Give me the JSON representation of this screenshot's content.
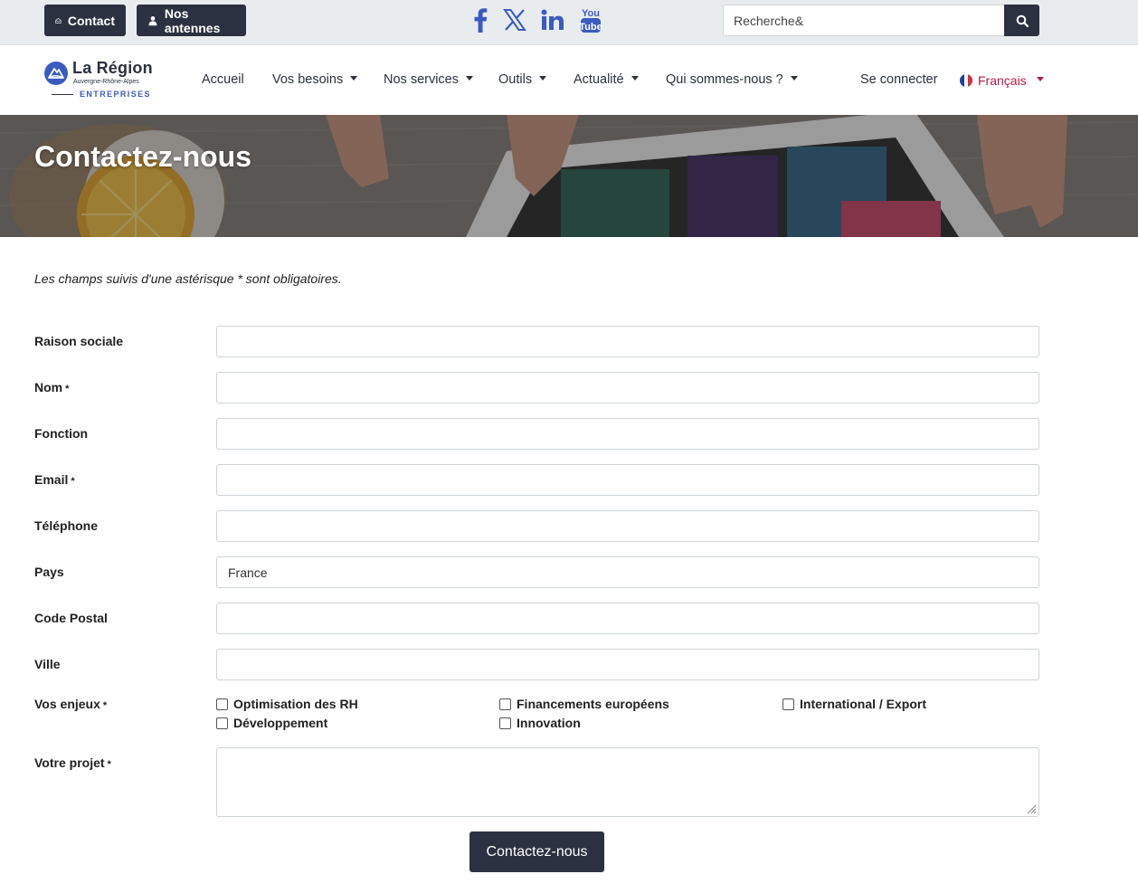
{
  "topbar": {
    "contact_label": "Contact",
    "antennes_label": "Nos antennes",
    "social": {
      "facebook_icon": "facebook-icon",
      "x_icon": "x-twitter-icon",
      "linkedin_icon": "linkedin-icon",
      "youtube_icon": "youtube-icon"
    },
    "search_value": "Recherche&",
    "colors": {
      "bar_bg": "#e9ecef",
      "button_bg": "#2b3140",
      "social": "#3b5bc1"
    }
  },
  "logo": {
    "title": "La Région",
    "subtitle": "Auvergne-Rhône-Alpes",
    "tagline": "ENTREPRISES"
  },
  "nav": {
    "items": [
      {
        "label": "Accueil"
      },
      {
        "label": "Vos besoins"
      },
      {
        "label": "Nos services"
      },
      {
        "label": "Outils"
      },
      {
        "label": "Actualité"
      },
      {
        "label": "Qui sommes-nous ?"
      }
    ],
    "login_label": "Se connecter",
    "language_label": "Français",
    "accent": "#b01d45"
  },
  "banner": {
    "title": "Contactez-nous"
  },
  "form": {
    "required_note": "Les champs suivis d'une astérisque * sont obligatoires.",
    "required_mark": "*",
    "fields": [
      {
        "label": "Raison sociale",
        "value": ""
      },
      {
        "label": "Nom",
        "value": ""
      },
      {
        "label": "Fonction",
        "value": ""
      },
      {
        "label": "Email",
        "value": ""
      },
      {
        "label": "Téléphone",
        "value": ""
      },
      {
        "label": "Pays",
        "value": "France"
      },
      {
        "label": "Code Postal",
        "value": ""
      },
      {
        "label": "Ville",
        "value": ""
      }
    ],
    "enjeux_label": "Vos enjeux",
    "enjeux_options": [
      {
        "label": "Optimisation des RH",
        "checked": false
      },
      {
        "label": "Financements européens",
        "checked": false
      },
      {
        "label": "International / Export",
        "checked": false
      },
      {
        "label": "Développement",
        "checked": false
      },
      {
        "label": "Innovation",
        "checked": false
      }
    ],
    "projet_label": "Votre projet",
    "projet_value": "",
    "submit_label": "Contactez-nous"
  }
}
